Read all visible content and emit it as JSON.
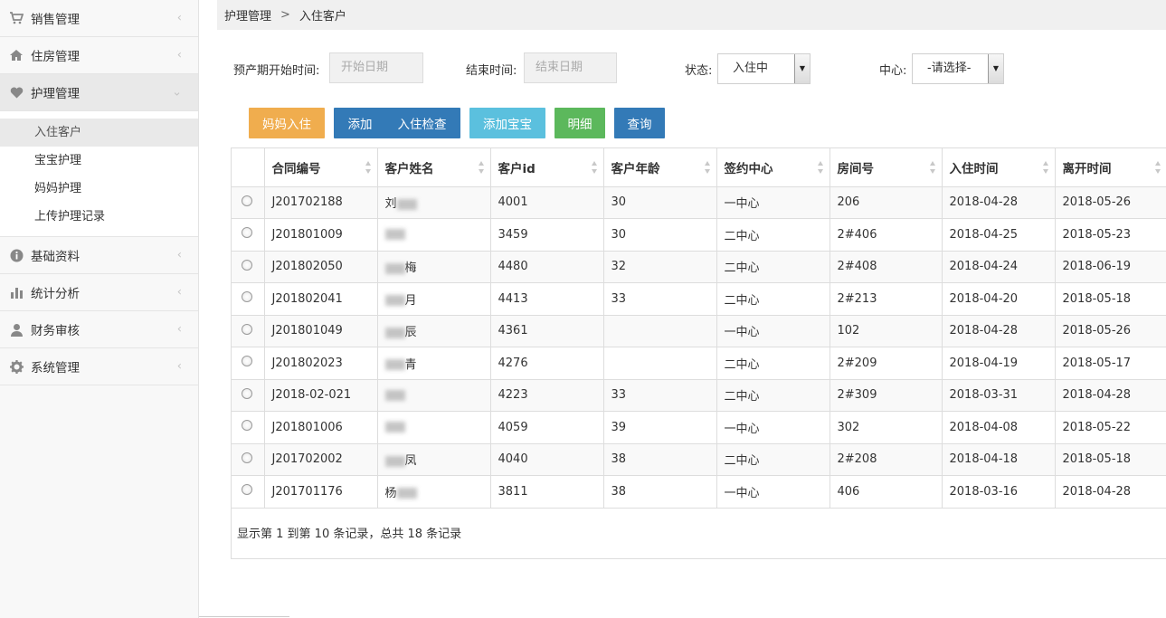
{
  "sidebar": {
    "items": [
      {
        "label": "销售管理",
        "icon": "cart-icon"
      },
      {
        "label": "住房管理",
        "icon": "home-icon"
      },
      {
        "label": "护理管理",
        "icon": "heart-icon"
      },
      {
        "label": "基础资料",
        "icon": "info-icon"
      },
      {
        "label": "统计分析",
        "icon": "bar-chart-icon"
      },
      {
        "label": "财务审核",
        "icon": "user-icon"
      },
      {
        "label": "系统管理",
        "icon": "gear-icon"
      }
    ],
    "submenu": [
      "入住客户",
      "宝宝护理",
      "妈妈护理",
      "上传护理记录"
    ]
  },
  "breadcrumb": {
    "parent": "护理管理",
    "separator": ">",
    "current": "入住客户"
  },
  "filters": {
    "start_label": "预产期开始时间:",
    "start_placeholder": "开始日期",
    "end_label": "结束时间:",
    "end_placeholder": "结束日期",
    "status_label": "状态:",
    "status_value": "入住中",
    "center_label": "中心:",
    "center_value": "-请选择-"
  },
  "buttons": {
    "mom_checkin": "妈妈入住",
    "add_check": "添加",
    "add_check_suffix": "入住检查",
    "add_baby": "添加宝宝",
    "detail": "明细",
    "query": "查询"
  },
  "table": {
    "headers": [
      "合同编号",
      "客户姓名",
      "客户id",
      "客户年龄",
      "签约中心",
      "房间号",
      "入住时间",
      "离开时间"
    ],
    "rows": [
      [
        "J201702188",
        "刘",
        "4001",
        "30",
        "一中心",
        "206",
        "2018-04-28",
        "2018-05-26"
      ],
      [
        "J201801009",
        "",
        "3459",
        "30",
        "二中心",
        "2#406",
        "2018-04-25",
        "2018-05-23"
      ],
      [
        "J201802050",
        "梅",
        "4480",
        "32",
        "二中心",
        "2#408",
        "2018-04-24",
        "2018-06-19"
      ],
      [
        "J201802041",
        "月",
        "4413",
        "33",
        "二中心",
        "2#213",
        "2018-04-20",
        "2018-05-18"
      ],
      [
        "J201801049",
        "辰",
        "4361",
        "",
        "一中心",
        "102",
        "2018-04-28",
        "2018-05-26"
      ],
      [
        "J201802023",
        "青",
        "4276",
        "",
        "二中心",
        "2#209",
        "2018-04-19",
        "2018-05-17"
      ],
      [
        "J2018-02-021",
        "",
        "4223",
        "33",
        "二中心",
        "2#309",
        "2018-03-31",
        "2018-04-28"
      ],
      [
        "J201801006",
        "",
        "4059",
        "39",
        "一中心",
        "302",
        "2018-04-08",
        "2018-05-22"
      ],
      [
        "J201702002",
        "凤",
        "4040",
        "38",
        "二中心",
        "2#208",
        "2018-04-18",
        "2018-05-18"
      ],
      [
        "J201701176",
        "杨",
        "3811",
        "38",
        "一中心",
        "406",
        "2018-03-16",
        "2018-04-28"
      ]
    ]
  },
  "pager": {
    "summary": "显示第 1 到第 10 条记录，总共 18 条记录"
  },
  "colors": {
    "orange": "#f0ad4e",
    "blue": "#337ab7",
    "cyan": "#5bc0de",
    "green": "#5cb85c"
  }
}
